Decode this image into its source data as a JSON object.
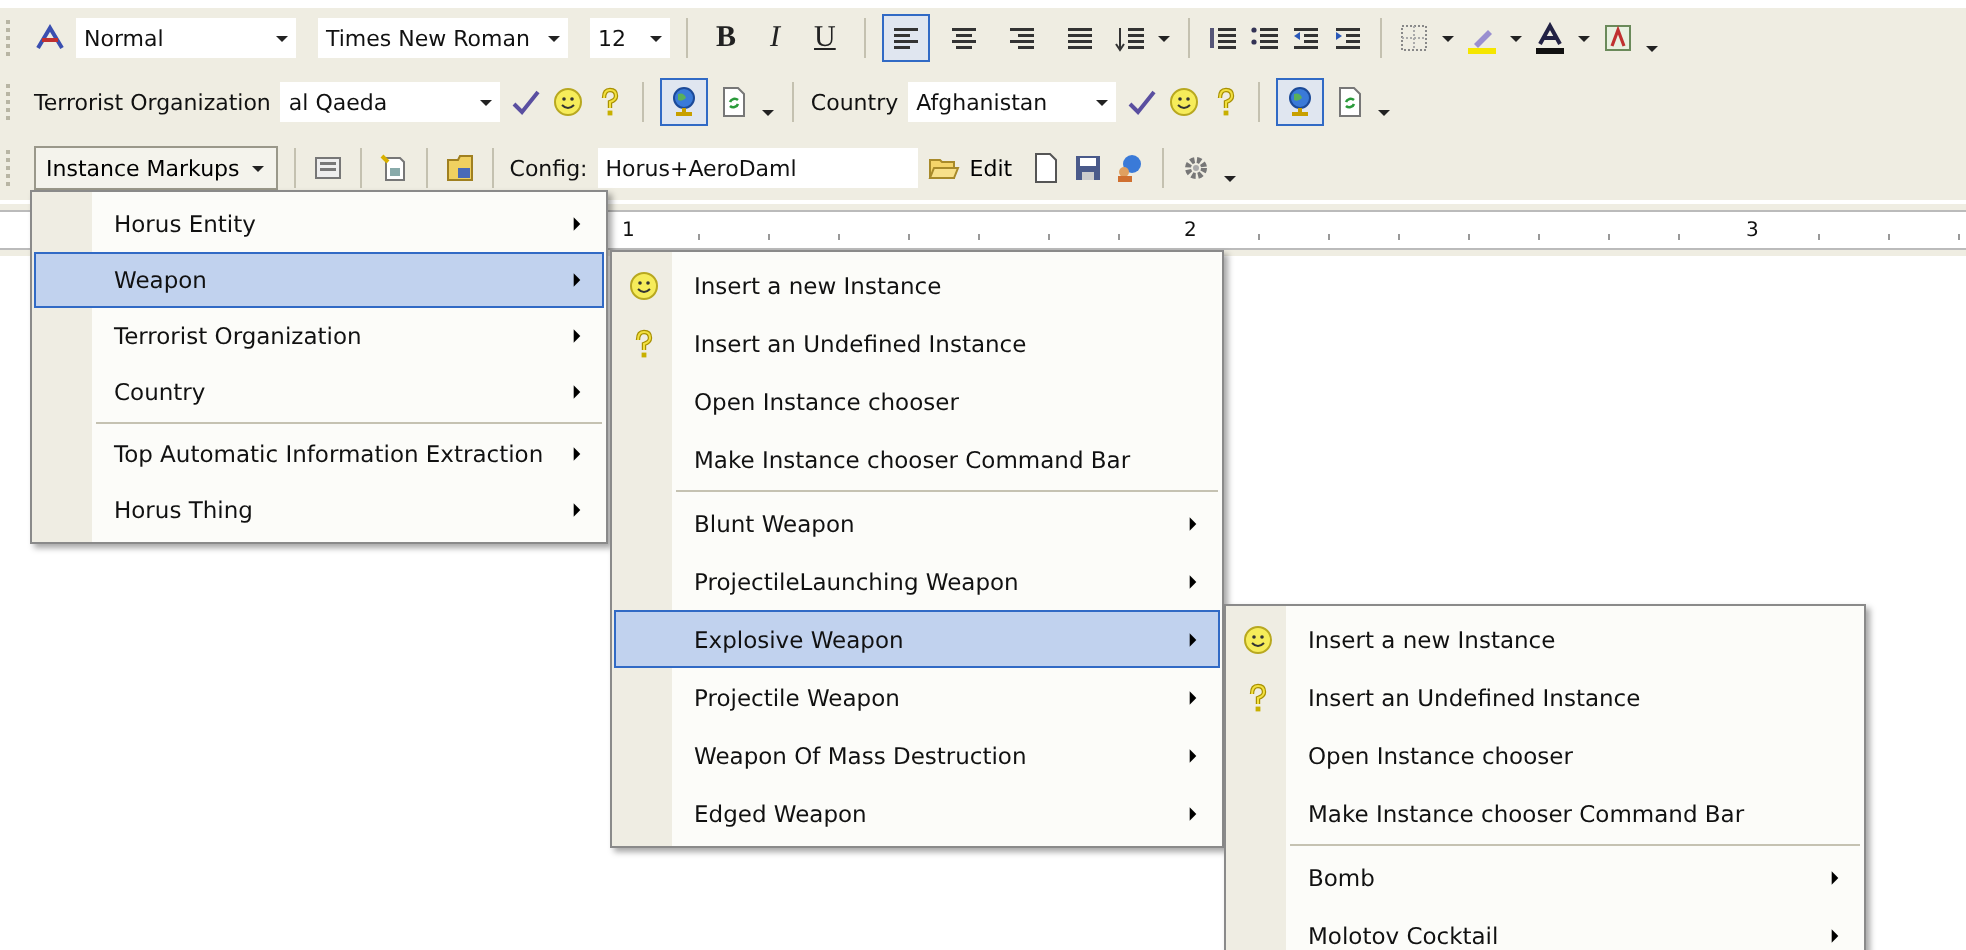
{
  "formatting_toolbar": {
    "style": "Normal",
    "font": "Times New Roman",
    "size": "12",
    "bold": "B",
    "italic": "I",
    "underline": "U",
    "alignment": [
      {
        "selected": true
      },
      {
        "selected": false
      },
      {
        "selected": false
      },
      {
        "selected": false
      }
    ]
  },
  "instance_toolbar": {
    "groups": [
      {
        "label": "Terrorist Organization",
        "value": "al Qaeda",
        "globe_pressed": true
      },
      {
        "label": "Country",
        "value": "Afghanistan",
        "globe_pressed": true
      }
    ]
  },
  "markup_toolbar": {
    "menu_button": "Instance Markups",
    "config_label": "Config:",
    "config_value": "Horus+AeroDaml",
    "edit_button": "Edit"
  },
  "ruler": {
    "labels": [
      "1",
      "2",
      "3"
    ]
  },
  "menus": [
    {
      "items": [
        {
          "label": "Horus Entity",
          "kind": "submenu",
          "selected": false,
          "divider_before": false
        },
        {
          "label": "Weapon",
          "kind": "submenu",
          "selected": true,
          "divider_before": false
        },
        {
          "label": "Terrorist Organization",
          "kind": "submenu",
          "selected": false,
          "divider_before": false
        },
        {
          "label": "Country",
          "kind": "submenu",
          "selected": false,
          "divider_before": false
        },
        {
          "label": "Top Automatic Information Extraction",
          "kind": "submenu",
          "selected": false,
          "divider_before": true
        },
        {
          "label": "Horus Thing",
          "kind": "submenu",
          "selected": false,
          "divider_before": false
        }
      ]
    },
    {
      "items": [
        {
          "label": "Insert a new Instance",
          "kind": "new",
          "selected": false,
          "divider_before": false
        },
        {
          "label": "Insert an Undefined Instance",
          "kind": "undefined",
          "selected": false,
          "divider_before": false
        },
        {
          "label": "Open Instance chooser",
          "kind": "command",
          "selected": false,
          "divider_before": false
        },
        {
          "label": "Make Instance chooser Command Bar",
          "kind": "command",
          "selected": false,
          "divider_before": false
        },
        {
          "label": "Blunt Weapon",
          "kind": "submenu",
          "selected": false,
          "divider_before": true
        },
        {
          "label": "ProjectileLaunching Weapon",
          "kind": "submenu",
          "selected": false,
          "divider_before": false
        },
        {
          "label": "Explosive Weapon",
          "kind": "submenu",
          "selected": true,
          "divider_before": false
        },
        {
          "label": "Projectile Weapon",
          "kind": "submenu",
          "selected": false,
          "divider_before": false
        },
        {
          "label": "Weapon Of Mass Destruction",
          "kind": "submenu",
          "selected": false,
          "divider_before": false
        },
        {
          "label": "Edged Weapon",
          "kind": "submenu",
          "selected": false,
          "divider_before": false
        }
      ]
    },
    {
      "items": [
        {
          "label": "Insert a new Instance",
          "kind": "new",
          "selected": false,
          "divider_before": false
        },
        {
          "label": "Insert an Undefined Instance",
          "kind": "undefined",
          "selected": false,
          "divider_before": false
        },
        {
          "label": "Open Instance chooser",
          "kind": "command",
          "selected": false,
          "divider_before": false
        },
        {
          "label": "Make Instance chooser Command Bar",
          "kind": "command",
          "selected": false,
          "divider_before": false
        },
        {
          "label": "Bomb",
          "kind": "submenu",
          "selected": false,
          "divider_before": true
        },
        {
          "label": "Molotov Cocktail",
          "kind": "submenu",
          "selected": false,
          "divider_before": false
        }
      ]
    }
  ]
}
